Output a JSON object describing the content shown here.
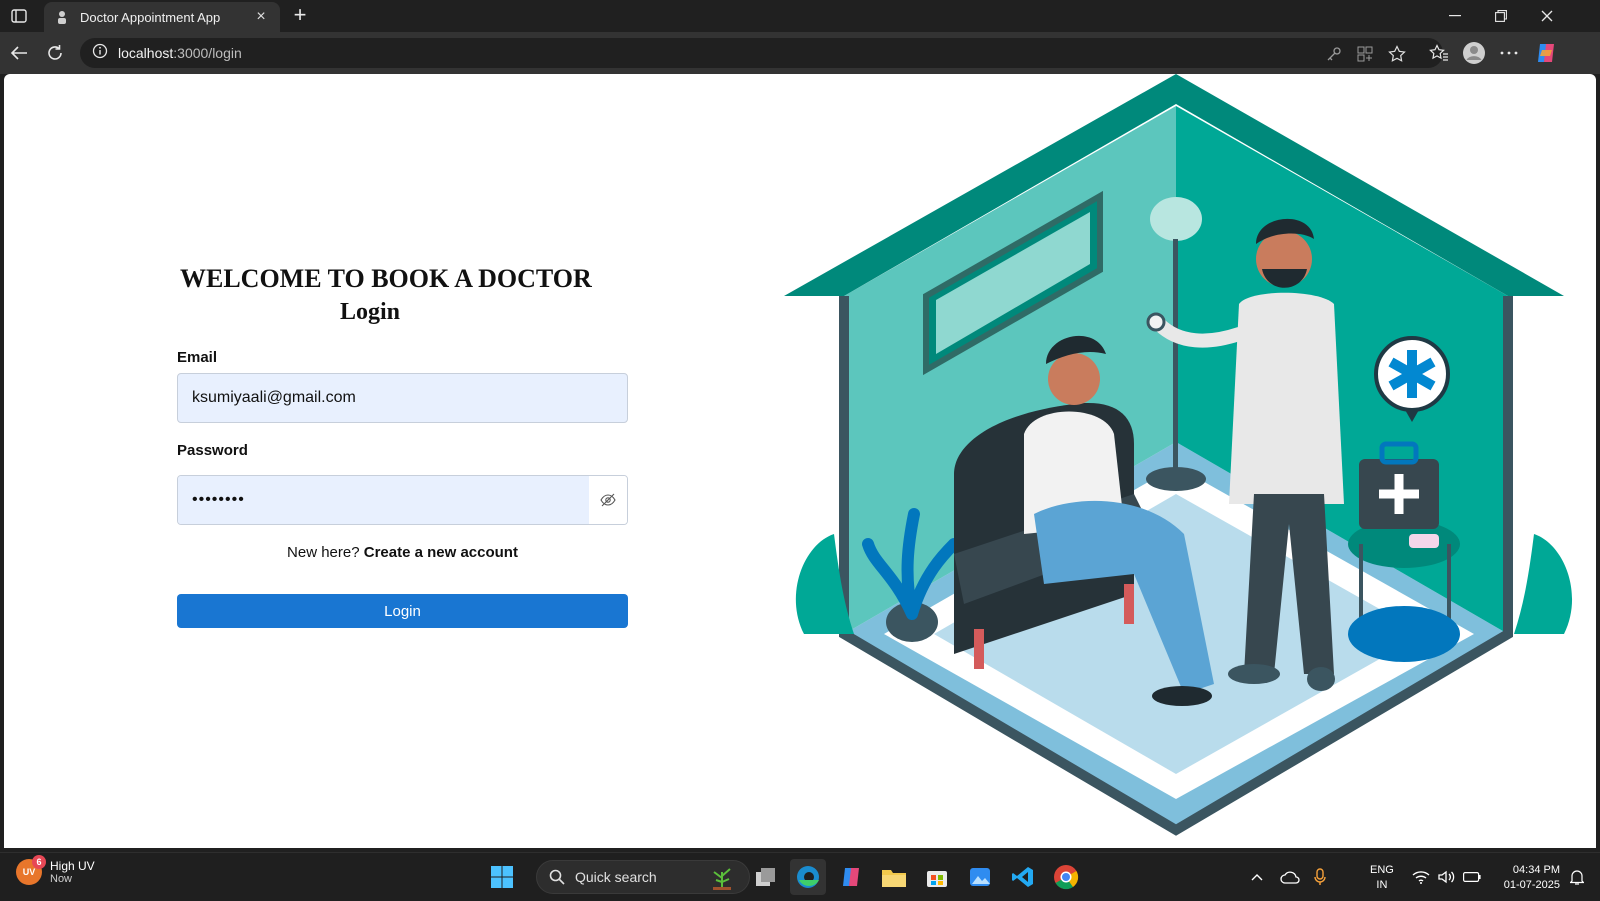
{
  "browser": {
    "tab_title": "Doctor Appointment App",
    "url_host": "localhost",
    "url_path": ":3000/login",
    "close_tab_label": "×",
    "new_tab_label": "+"
  },
  "page": {
    "heading": "WELCOME TO BOOK A DOCTOR",
    "subheading": "Login",
    "email_label": "Email",
    "email_value": "ksumiyaali@gmail.com",
    "password_label": "Password",
    "password_value": "••••••••",
    "signup_prompt": "New here?",
    "signup_link": "Create a new account",
    "login_button": "Login"
  },
  "taskbar": {
    "weather_title": "High UV",
    "weather_sub": "Now",
    "weather_badge": "6",
    "weather_icon_text": "UV",
    "search_placeholder": "Quick search",
    "lang_1": "ENG",
    "lang_2": "IN",
    "time": "04:34 PM",
    "date": "01-07-2025"
  },
  "colors": {
    "accent": "#1976d2",
    "input_fill": "#e8f0fe",
    "teal_dark": "#00897b",
    "teal": "#5cc6bd"
  }
}
